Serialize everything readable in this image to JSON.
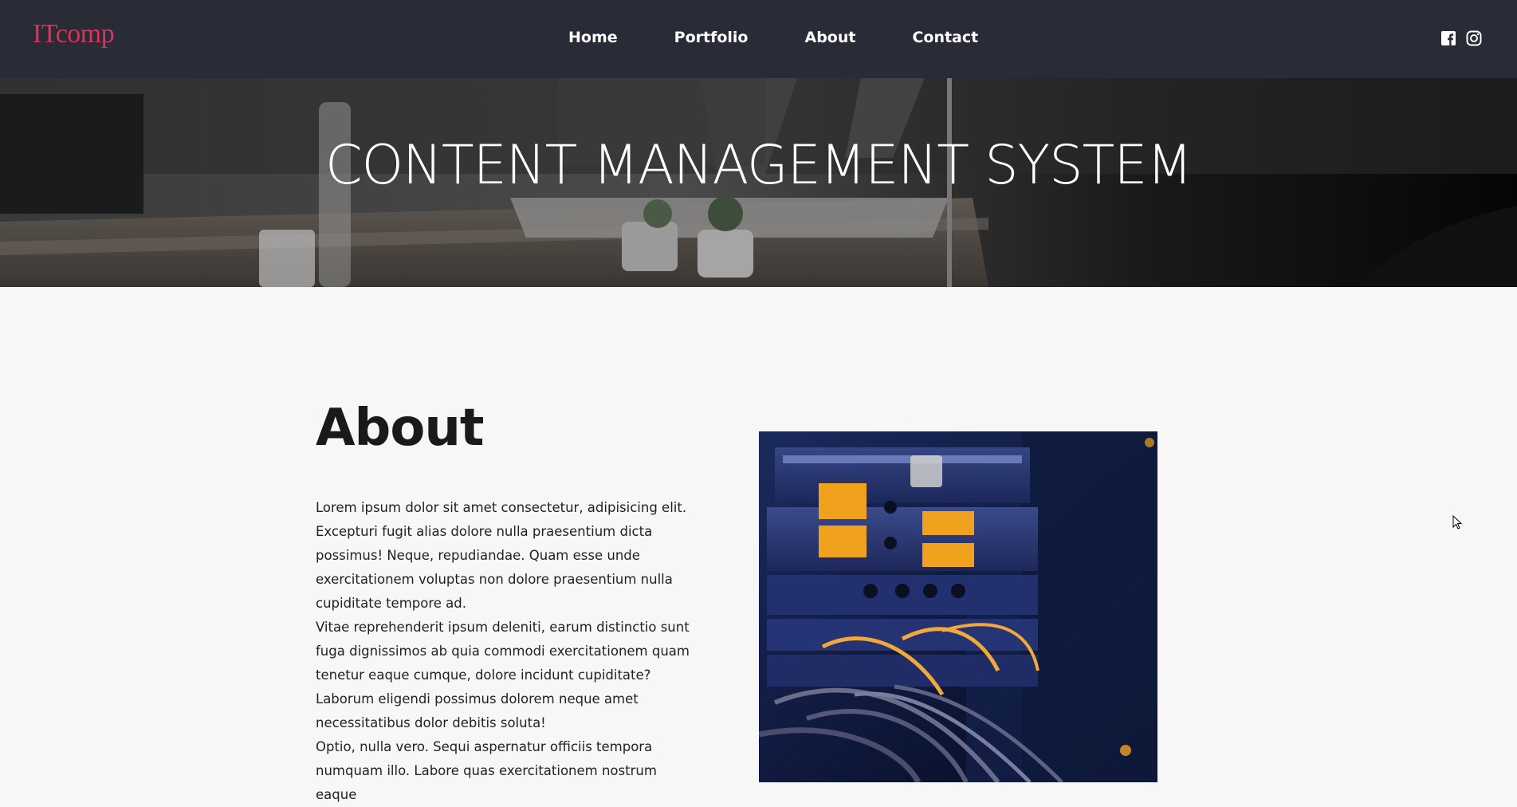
{
  "header": {
    "logo": "ITcomp",
    "nav": [
      {
        "label": "Home"
      },
      {
        "label": "Portfolio"
      },
      {
        "label": "About"
      },
      {
        "label": "Contact"
      }
    ],
    "social_icons": [
      "facebook-icon",
      "instagram-icon"
    ]
  },
  "hero": {
    "title": "CONTENT MANAGEMENT SYSTEM"
  },
  "about": {
    "heading": "About",
    "paragraphs": [
      "Lorem ipsum dolor sit amet consectetur, adipisicing elit. Excepturi fugit alias dolore nulla praesentium dicta possimus! Neque, repudiandae. Quam esse unde exercitationem voluptas non dolore praesentium nulla cupiditate tempore ad.",
      "Vitae reprehenderit ipsum deleniti, earum distinctio sunt fuga dignissimos ab quia commodi exercitationem quam tenetur eaque cumque, dolore incidunt cupiditate? Laborum eligendi possimus dolorem neque amet necessitatibus dolor debitis soluta!",
      "Optio, nulla vero. Sequi aspernatur officiis tempora numquam illo. Labore quas exercitationem nostrum eaque"
    ]
  },
  "colors": {
    "navbar_bg": "#292b36",
    "logo": "#e0315c",
    "page_bg": "#f7f7f7",
    "text": "#222222"
  }
}
